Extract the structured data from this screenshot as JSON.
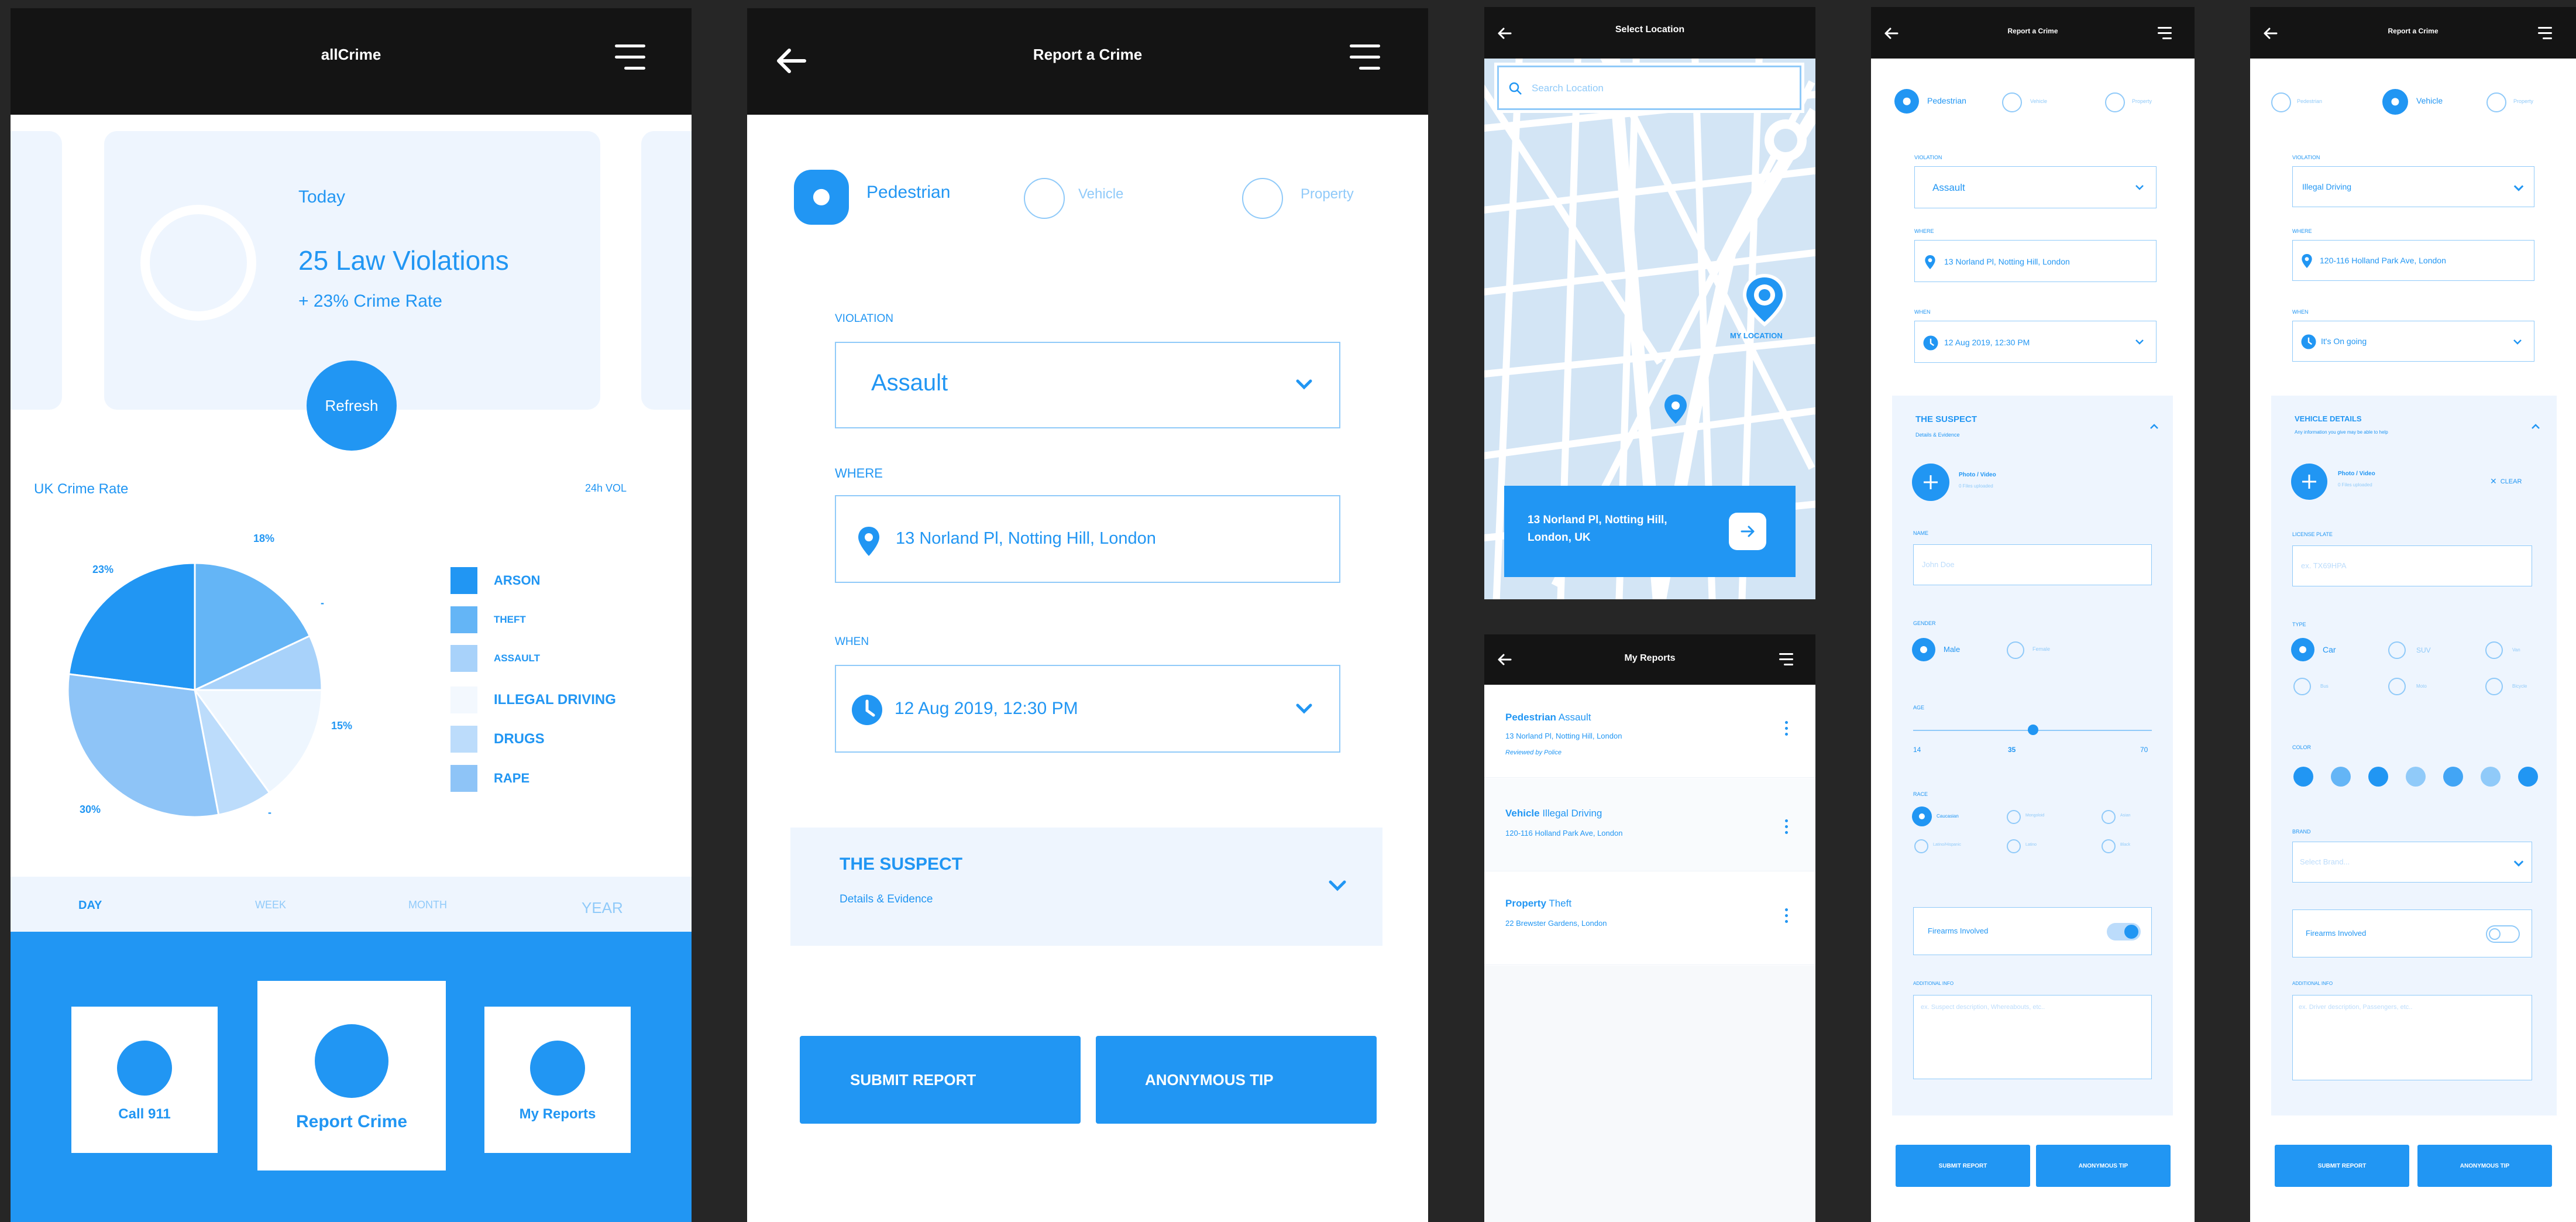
{
  "screen1": {
    "app_title": "allCrime",
    "today_label": "Today",
    "violations": "25 Law Violations",
    "crime_rate_change": "+ 23% Crime Rate",
    "refresh": "Refresh",
    "chart_title": "UK Crime Rate",
    "chart_period": "24h VOL",
    "tabs": [
      "DAY",
      "WEEK",
      "MONTH",
      "YEAR"
    ],
    "actions": {
      "call": "Call 911",
      "report": "Report Crime",
      "my_reports": "My Reports"
    }
  },
  "chart_data": {
    "type": "pie",
    "title": "UK Crime Rate",
    "labels": [
      "ARSON",
      "THEFT",
      "ASSAULT",
      "ILLEGAL DRIVING",
      "DRUGS",
      "RAPE"
    ],
    "values": [
      23,
      18,
      7,
      15,
      7,
      30
    ],
    "value_labels": [
      "23%",
      "18%",
      "-",
      "15%",
      "-",
      "30%"
    ],
    "colors": [
      "#2196f3",
      "#64b5f6",
      "#a8d2fa",
      "#eef6fe",
      "#bcdcfb",
      "#8ec4f7"
    ],
    "legend_placement": "right"
  },
  "screen2": {
    "title": "Report a Crime",
    "types": [
      "Pedestrian",
      "Vehicle",
      "Property"
    ],
    "violation_label": "VIOLATION",
    "violation_value": "Assault",
    "where_label": "WHERE",
    "where_value": "13 Norland Pl, Notting Hill, London",
    "when_label": "WHEN",
    "when_value": "12 Aug  2019, 12:30 PM",
    "suspect_title": "THE SUSPECT",
    "suspect_sub": "Details & Evidence",
    "submit": "SUBMIT REPORT",
    "anon": "ANONYMOUS TIP"
  },
  "screen3": {
    "title": "Select Location",
    "search_placeholder": "Search Location",
    "my_location": "MY LOCATION",
    "address": "13 Norland Pl, Notting Hill, London, UK"
  },
  "screen4": {
    "title": "My Reports",
    "reports": [
      {
        "type": "Pedestrian",
        "kind": "Assault",
        "address": "13 Norland Pl, Notting Hill, London",
        "status": "Reviewed by Police"
      },
      {
        "type": "Vehicle",
        "kind": "Illegal Driving",
        "address": "120-116 Holland Park Ave, London",
        "status": ""
      },
      {
        "type": "Property",
        "kind": "Theft",
        "address": "22 Brewster Gardens, London",
        "status": ""
      }
    ]
  },
  "screen5": {
    "title": "Report a Crime",
    "types": [
      "Pedestrian",
      "Vehicle",
      "Property"
    ],
    "violation_label": "VIOLATION",
    "violation_value": "Assault",
    "where_label": "WHERE",
    "where_value": "13 Norland Pl, Notting Hill, London",
    "when_label": "WHEN",
    "when_value": "12 Aug  2019, 12:30 PM",
    "suspect_title": "THE SUSPECT",
    "suspect_sub": "Details & Evidence",
    "photo_title": "Photo / Video",
    "photo_sub": "0 Files uploaded",
    "name_label": "NAME",
    "name_placeholder": "John Doe",
    "gender_label": "GENDER",
    "genders": [
      "Male",
      "Female"
    ],
    "age_label": "AGE",
    "age_min": "14",
    "age_value": "35",
    "age_max": "70",
    "race_label": "RACE",
    "races": [
      "Caucasian",
      "Mongoloid",
      "Asian",
      "Latino/Hispanic",
      "Latino",
      "Black"
    ],
    "firearms": "Firearms Involved",
    "firearms_on": true,
    "additional_label": "ADDITIONAL INFO",
    "additional_placeholder": "ex. Suspect description, Whereabouts, etc..",
    "submit": "SUBMIT REPORT",
    "anon": "ANONYMOUS TIP"
  },
  "screen6": {
    "title": "Report a Crime",
    "types": [
      "Pedestrian",
      "Vehicle",
      "Property"
    ],
    "violation_label": "VIOLATION",
    "violation_value": "Illegal Driving",
    "where_label": "WHERE",
    "where_value": "120-116 Holland Park Ave, London",
    "when_label": "WHEN",
    "when_value": "It's On going",
    "vehicle_title": "VEHICLE DETAILS",
    "vehicle_sub": "Any information you give may be able to help",
    "photo_title": "Photo / Video",
    "photo_sub": "0 Files uploaded",
    "clear": "CLEAR",
    "plate_label": "LICENSE PLATE",
    "plate_placeholder": "ex. TX69HPA",
    "type_label": "TYPE",
    "vehicle_types": [
      "Car",
      "SUV",
      "Van",
      "Bus",
      "Moto",
      "Bicycle"
    ],
    "color_label": "COLOR",
    "colors": [
      "#2196f3",
      "#64b5f6",
      "#2196f3",
      "#90caf9",
      "#42a5f5",
      "#90caf9",
      "#2196f3"
    ],
    "brand_label": "BRAND",
    "brand_placeholder": "Select Brand...",
    "firearms": "Firearms Involved",
    "firearms_on": false,
    "additional_label": "ADDITIONAL INFO",
    "additional_placeholder": "ex. Driver description, Passengers, etc..",
    "submit": "SUBMIT REPORT",
    "anon": "ANONYMOUS TIP"
  }
}
